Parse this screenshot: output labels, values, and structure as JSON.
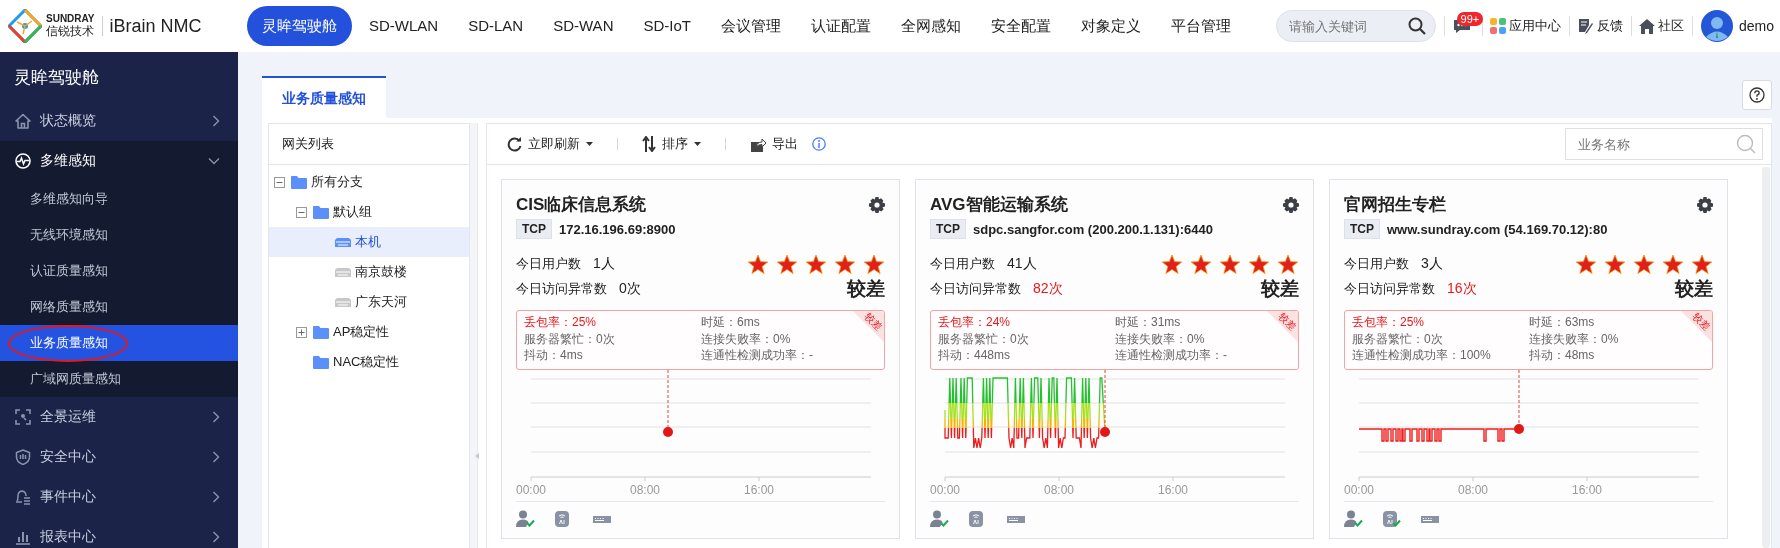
{
  "header": {
    "logo_brand": "SUNDRAY",
    "logo_name": "信锐技术",
    "product": "iBrain NMC",
    "nav": [
      {
        "label": "灵眸驾驶舱",
        "selected": true
      },
      {
        "label": "SD-WLAN",
        "selected": false
      },
      {
        "label": "SD-LAN",
        "selected": false
      },
      {
        "label": "SD-WAN",
        "selected": false
      },
      {
        "label": "SD-IoT",
        "selected": false
      },
      {
        "label": "会议管理",
        "selected": false
      },
      {
        "label": "认证配置",
        "selected": false
      },
      {
        "label": "全网感知",
        "selected": false
      },
      {
        "label": "安全配置",
        "selected": false
      },
      {
        "label": "对象定义",
        "selected": false
      },
      {
        "label": "平台管理",
        "selected": false
      }
    ],
    "search": {
      "placeholder": "请输入关键词"
    },
    "messages": {
      "badge": "99+"
    },
    "links": [
      {
        "kind": "apps",
        "label": "应用中心"
      },
      {
        "kind": "feedback",
        "label": "反馈"
      },
      {
        "kind": "community",
        "label": "社区"
      }
    ],
    "user": {
      "name": "demo"
    }
  },
  "sidebar": {
    "title": "灵眸驾驶舱",
    "items": [
      {
        "label": "状态概览",
        "expanded": false
      },
      {
        "label": "多维感知",
        "expanded": true,
        "children": [
          {
            "label": "多维感知向导",
            "selected": false,
            "circled": false
          },
          {
            "label": "无线环境感知",
            "selected": false,
            "circled": false
          },
          {
            "label": "认证质量感知",
            "selected": false,
            "circled": false
          },
          {
            "label": "网络质量感知",
            "selected": false,
            "circled": false
          },
          {
            "label": "业务质量感知",
            "selected": true,
            "circled": true
          },
          {
            "label": "广域网质量感知",
            "selected": false,
            "circled": false
          }
        ]
      },
      {
        "label": "全景运维",
        "expanded": false
      },
      {
        "label": "安全中心",
        "expanded": false
      },
      {
        "label": "事件中心",
        "expanded": false
      },
      {
        "label": "报表中心",
        "expanded": false
      }
    ]
  },
  "tabs": [
    {
      "label": "业务质量感知",
      "selected": true
    }
  ],
  "gateway_list": {
    "title": "网关列表",
    "tree": [
      {
        "kind": "folder",
        "label": "所有分支",
        "expanded": true,
        "selected": false,
        "children": [
          {
            "kind": "folder",
            "label": "默认组",
            "expanded": true,
            "selected": false,
            "children": [
              {
                "kind": "device",
                "label": "本机",
                "selected": true
              },
              {
                "kind": "device",
                "label": "南京鼓楼",
                "selected": false
              },
              {
                "kind": "device",
                "label": "广东天河",
                "selected": false
              }
            ]
          },
          {
            "kind": "folder",
            "label": "AP稳定性",
            "expanded": false,
            "selected": false
          },
          {
            "kind": "folder",
            "label": "NAC稳定性",
            "selected": false
          }
        ]
      }
    ]
  },
  "toolbar": {
    "actions": [
      {
        "kind": "refresh",
        "label": "立即刷新",
        "dropdown": true
      },
      {
        "kind": "sort",
        "label": "排序",
        "dropdown": true
      },
      {
        "kind": "export",
        "label": "导出",
        "dropdown": false
      }
    ],
    "search": {
      "placeholder": "业务名称"
    }
  },
  "services": [
    {
      "title": "CIS临床信息系统",
      "protocol": "TCP",
      "address": "172.16.196.69:8900",
      "users_label": "今日用户数",
      "users": "1人",
      "abnormal_label": "今日访问异常数",
      "abnormal": "0次",
      "abnormal_alert": false,
      "stars": 5,
      "rating": "较差",
      "badge": "较差",
      "metrics": [
        {
          "text": "丢包率：25%",
          "alert": true
        },
        {
          "text": "时延：6ms",
          "alert": false
        },
        {
          "text": "服务器繁忙：0次",
          "alert": false
        },
        {
          "text": "连接失败率：0%",
          "alert": false
        },
        {
          "text": "抖动：4ms",
          "alert": false
        },
        {
          "text": "连通性检测成功率：-",
          "alert": false
        }
      ],
      "time_labels": [
        "00:00",
        "08:00",
        "16:00"
      ],
      "status_icons": [
        {
          "kind": "user",
          "checked": true
        },
        {
          "kind": "ai",
          "checked": false
        },
        {
          "kind": "device",
          "checked": false
        }
      ]
    },
    {
      "title": "AVG智能运输系统",
      "protocol": "TCP",
      "address": "sdpc.sangfor.com (200.200.1.131):6440",
      "users_label": "今日用户数",
      "users": "41人",
      "abnormal_label": "今日访问异常数",
      "abnormal": "82次",
      "abnormal_alert": true,
      "stars": 5,
      "rating": "较差",
      "badge": "较差",
      "metrics": [
        {
          "text": "丢包率：24%",
          "alert": true
        },
        {
          "text": "时延：31ms",
          "alert": false
        },
        {
          "text": "服务器繁忙：0次",
          "alert": false
        },
        {
          "text": "连接失败率：0%",
          "alert": false
        },
        {
          "text": "抖动：448ms",
          "alert": false
        },
        {
          "text": "连通性检测成功率：-",
          "alert": false
        }
      ],
      "time_labels": [
        "00:00",
        "08:00",
        "16:00"
      ],
      "status_icons": [
        {
          "kind": "user",
          "checked": true
        },
        {
          "kind": "ai",
          "checked": false
        },
        {
          "kind": "device",
          "checked": false
        }
      ]
    },
    {
      "title": "官网招生专栏",
      "protocol": "TCP",
      "address": "www.sundray.com (54.169.70.12):80",
      "users_label": "今日用户数",
      "users": "3人",
      "abnormal_label": "今日访问异常数",
      "abnormal": "16次",
      "abnormal_alert": true,
      "stars": 5,
      "rating": "较差",
      "badge": "较差",
      "metrics": [
        {
          "text": "丢包率：25%",
          "alert": true
        },
        {
          "text": "时延：63ms",
          "alert": false
        },
        {
          "text": "服务器繁忙：0次",
          "alert": false
        },
        {
          "text": "连接失败率：0%",
          "alert": false
        },
        {
          "text": "连通性检测成功率：100%",
          "alert": false
        },
        {
          "text": "抖动：48ms",
          "alert": false
        }
      ],
      "time_labels": [
        "00:00",
        "08:00",
        "16:00"
      ],
      "status_icons": [
        {
          "kind": "user",
          "checked": true
        },
        {
          "kind": "ai",
          "checked": true
        },
        {
          "kind": "device",
          "checked": false
        }
      ]
    }
  ]
}
